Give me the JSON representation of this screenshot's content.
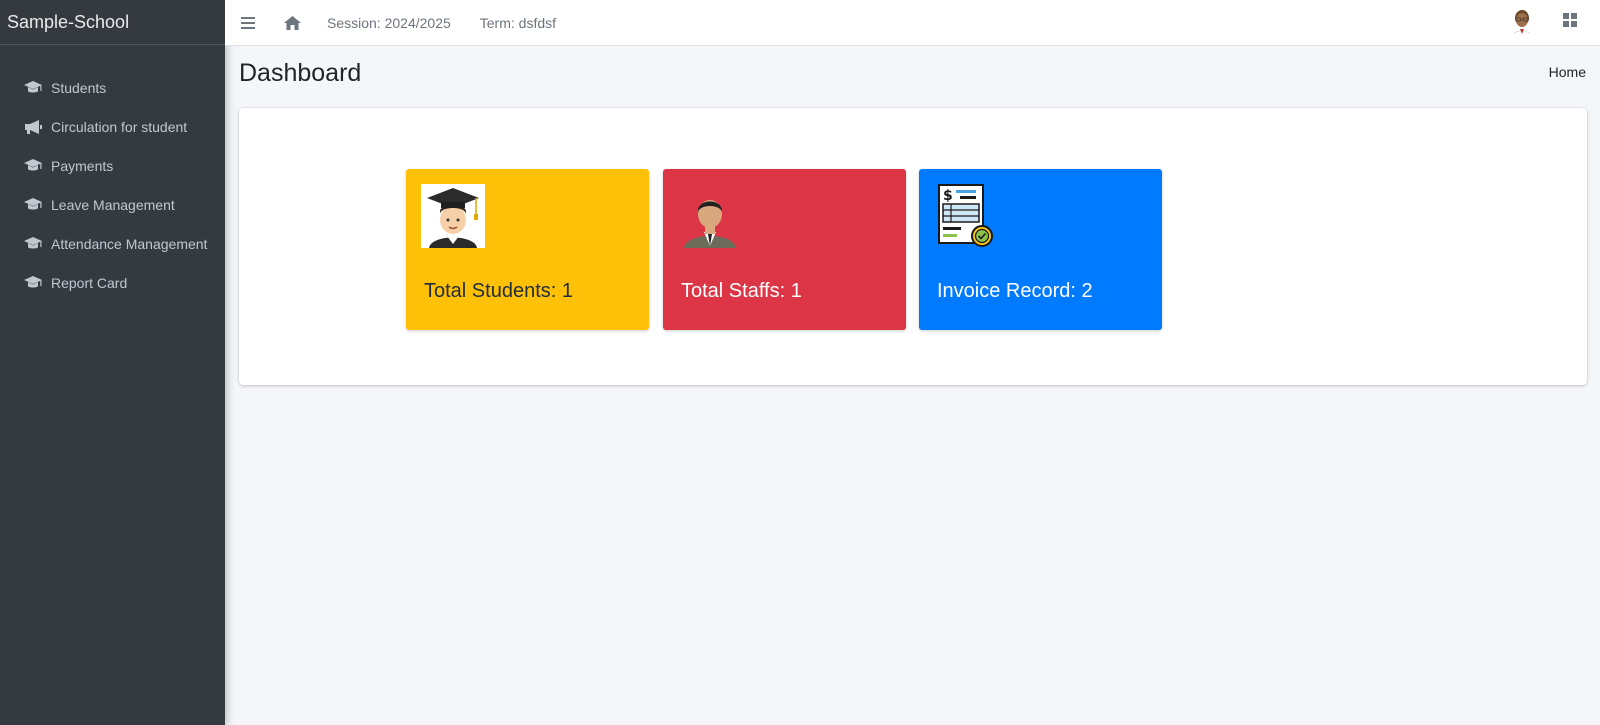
{
  "app": {
    "brand": "Sample-School"
  },
  "sidebar": {
    "items": [
      {
        "label": "Students",
        "icon": "graduation-cap-icon"
      },
      {
        "label": "Circulation for student",
        "icon": "bullhorn-icon"
      },
      {
        "label": "Payments",
        "icon": "graduation-cap-icon"
      },
      {
        "label": "Leave Management",
        "icon": "graduation-cap-icon"
      },
      {
        "label": "Attendance Management",
        "icon": "graduation-cap-icon"
      },
      {
        "label": "Report Card",
        "icon": "graduation-cap-icon"
      }
    ]
  },
  "topbar": {
    "session": "Session: 2024/2025",
    "term": "Term: dsfdsf"
  },
  "page": {
    "title": "Dashboard",
    "breadcrumb": "Home"
  },
  "stats": [
    {
      "label": "Total Students: 1",
      "color": "#ffc107",
      "icon": "student-graduate-icon"
    },
    {
      "label": "Total Staffs: 1",
      "color": "#dc3545",
      "icon": "staff-person-icon"
    },
    {
      "label": "Invoice Record: 2",
      "color": "#007bff",
      "icon": "invoice-icon"
    }
  ]
}
